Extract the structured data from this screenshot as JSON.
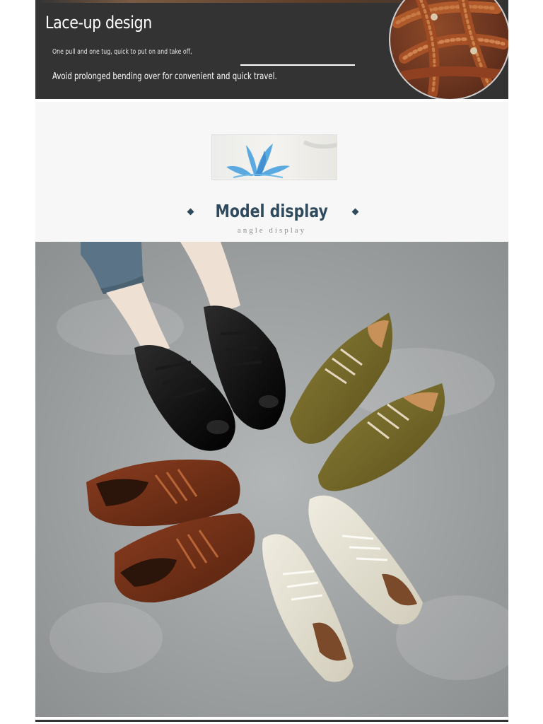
{
  "feature_banner": {
    "title": "Lace-up design",
    "line1": "One pull and one tug, quick to put on and take off,",
    "line2": "Avoid prolonged bending over for convenient and quick travel."
  },
  "section": {
    "title": "Model display",
    "subtitle": "angle display"
  },
  "product_photo": {
    "shoes": [
      {
        "color_name": "black",
        "hex": "#151515"
      },
      {
        "color_name": "olive",
        "hex": "#6f6424"
      },
      {
        "color_name": "brown",
        "hex": "#6a2c16"
      },
      {
        "color_name": "cream",
        "hex": "#e4e0d2"
      }
    ]
  },
  "colors": {
    "banner_bg": "#333333",
    "title_accent": "#2f4a5c",
    "background": "#a5a8a9"
  }
}
